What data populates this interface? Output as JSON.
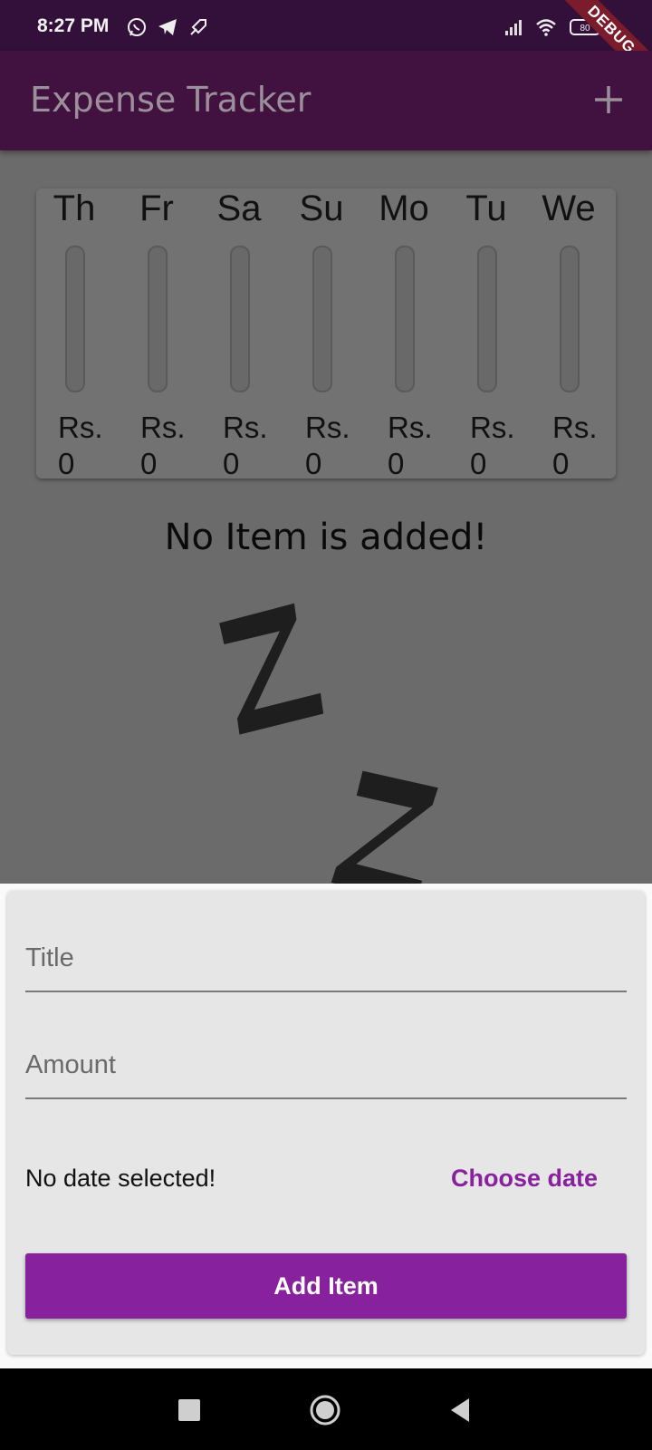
{
  "status_bar": {
    "time": "8:27 PM",
    "left_icons": [
      "whatsapp-icon",
      "telegram-icon",
      "rocket-icon"
    ],
    "right_icons": [
      "signal-icon",
      "wifi-icon",
      "battery-icon"
    ],
    "battery_level": "80",
    "debug_banner": "DEBUG"
  },
  "app_bar": {
    "title": "Expense Tracker",
    "action_icon": "add-icon"
  },
  "chart": {
    "days": [
      {
        "day": "Th",
        "currency": "Rs.",
        "amount": "0",
        "fraction": 0
      },
      {
        "day": "Fr",
        "currency": "Rs.",
        "amount": "0",
        "fraction": 0
      },
      {
        "day": "Sa",
        "currency": "Rs.",
        "amount": "0",
        "fraction": 0
      },
      {
        "day": "Su",
        "currency": "Rs.",
        "amount": "0",
        "fraction": 0
      },
      {
        "day": "Mo",
        "currency": "Rs.",
        "amount": "0",
        "fraction": 0
      },
      {
        "day": "Tu",
        "currency": "Rs.",
        "amount": "0",
        "fraction": 0
      },
      {
        "day": "We",
        "currency": "Rs.",
        "amount": "0",
        "fraction": 0
      }
    ]
  },
  "empty_state": {
    "message": "No Item is added!",
    "illustration": "sleeping-z-icon"
  },
  "form": {
    "title_placeholder": "Title",
    "title_value": "",
    "amount_placeholder": "Amount",
    "amount_value": "",
    "date_status": "No date selected!",
    "choose_date_label": "Choose date",
    "submit_label": "Add Item"
  },
  "colors": {
    "primary": "#88219d",
    "app_bar": "#41123f",
    "status_bar": "#33103a"
  },
  "nav_bar": {
    "buttons": [
      "recents-icon",
      "home-icon",
      "back-icon"
    ]
  }
}
